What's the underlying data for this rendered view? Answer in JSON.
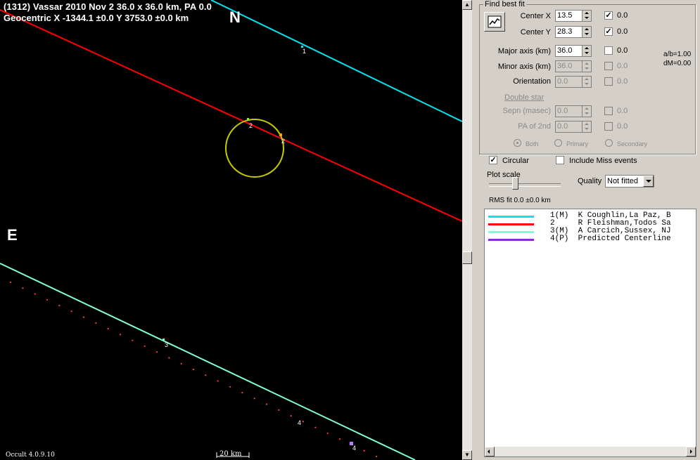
{
  "plot": {
    "title_line1": "(1312) Vassar  2010 Nov 2   36.0 x 36.0 km, PA 0.0",
    "title_line2": "Geocentric  X  -1344.1 ±0.0  Y 3753.0 ±0.0 km",
    "north_label": "N",
    "east_label": "E",
    "version": "Occult 4.0.9.10",
    "scale_label": "20 km",
    "chord_labels": [
      "1",
      "2",
      "2",
      "3",
      "4",
      "4"
    ],
    "colors": {
      "background": "#000000",
      "chord1": "#00e5ee",
      "chord2": "#ff0000",
      "chord3": "#7fffd4",
      "predicted": "#8a2be2",
      "ellipse": "#c8c800",
      "dots": "#ff4040"
    }
  },
  "panel": {
    "group_title": "Find best fit",
    "fit_icon": "chart-fit-icon",
    "center_x": {
      "label": "Center X",
      "value": "13.5",
      "checked": true,
      "check_value": "0.0"
    },
    "center_y": {
      "label": "Center Y",
      "value": "28.3",
      "checked": true,
      "check_value": "0.0"
    },
    "major_axis": {
      "label": "Major axis (km)",
      "value": "36.0",
      "checked": false,
      "check_value": "0.0"
    },
    "minor_axis": {
      "label": "Minor axis (km)",
      "value": "36.0",
      "checked": false,
      "check_value": "0.0"
    },
    "orientation": {
      "label": "Orientation",
      "value": "0.0",
      "checked": false,
      "check_value": "0.0"
    },
    "ratio_ab": "a/b=1.00",
    "ratio_dm": "dM=0.00",
    "double_star": "Double star",
    "sepn": {
      "label": "Sepn (masec)",
      "value": "0.0",
      "checked": false,
      "check_value": "0.0"
    },
    "pa_2nd": {
      "label": "PA of 2nd",
      "value": "0.0",
      "checked": false,
      "check_value": "0.0"
    },
    "radio_both": "Both",
    "radio_primary": "Primary",
    "radio_secondary": "Secondary",
    "circular_label": "Circular",
    "circular_checked": true,
    "miss_label": "Include Miss events",
    "miss_checked": false,
    "plot_scale_label": "Plot scale",
    "quality_label": "Quality",
    "quality_value": "Not fitted",
    "rms_label": "RMS fit 0.0 ±0.0 km",
    "observers": [
      {
        "color": "#00e5ee",
        "text": "1(M)  K Coughlin,La Paz, B"
      },
      {
        "color": "#ff0000",
        "text": "2     R Fleishman,Todos Sa"
      },
      {
        "color": "#7fffd4",
        "text": "3(M)  A Carcich,Sussex, NJ"
      },
      {
        "color": "#8a2be2",
        "text": "4(P)  Predicted Centerline"
      }
    ]
  }
}
